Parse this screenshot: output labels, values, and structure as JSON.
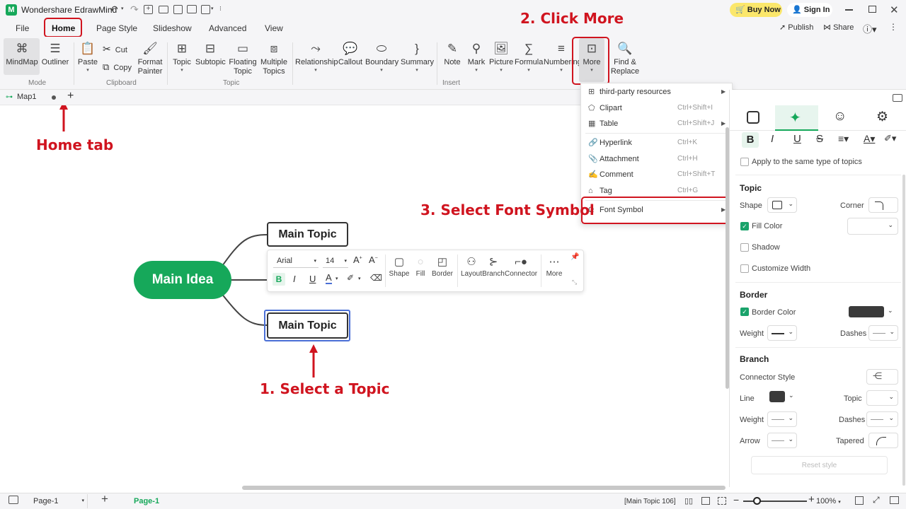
{
  "app": {
    "title": "Wondershare EdrawMind",
    "buy_now": "Buy Now",
    "sign_in": "Sign In",
    "publish": "Publish",
    "share": "Share"
  },
  "menu": {
    "file": "File",
    "home": "Home",
    "page_style": "Page Style",
    "slideshow": "Slideshow",
    "advanced": "Advanced",
    "view": "View"
  },
  "ribbon": {
    "mindmap": "MindMap",
    "outliner": "Outliner",
    "mode": "Mode",
    "paste": "Paste",
    "cut": "Cut",
    "copy": "Copy",
    "format_painter_1": "Format",
    "format_painter_2": "Painter",
    "clipboard": "Clipboard",
    "topic": "Topic",
    "subtopic": "Subtopic",
    "floating_1": "Floating",
    "floating_2": "Topic",
    "multiple_1": "Multiple",
    "multiple_2": "Topics",
    "topic_group": "Topic",
    "relationship": "Relationship",
    "callout": "Callout",
    "boundary": "Boundary",
    "summary": "Summary",
    "note": "Note",
    "mark": "Mark",
    "picture": "Picture",
    "formula": "Formula",
    "numbering": "Numbering",
    "more": "More",
    "insert": "Insert",
    "find_1": "Find &",
    "find_2": "Replace"
  },
  "doc_tab": {
    "name": "Map1"
  },
  "annotations": {
    "home_tab": "Home tab",
    "click_more": "2. Click More",
    "select_font_symbol": "3. Select Font Symbol",
    "select_topic": "1. Select a Topic"
  },
  "mindmap": {
    "main_idea": "Main Idea",
    "topic_top": "Main Topic",
    "topic_bottom": "Main Topic"
  },
  "floating_toolbar": {
    "font": "Arial",
    "size": "14",
    "shape": "Shape",
    "fill": "Fill",
    "border": "Border",
    "layout": "Layout",
    "branch": "Branch",
    "connector": "Connector",
    "more": "More"
  },
  "more_menu": {
    "items": [
      {
        "label": "third-party resources",
        "shortcut": ""
      },
      {
        "label": "Clipart",
        "shortcut": "Ctrl+Shift+I"
      },
      {
        "label": "Table",
        "shortcut": "Ctrl+Shift+J"
      },
      {
        "label": "Hyperlink",
        "shortcut": "Ctrl+K"
      },
      {
        "label": "Attachment",
        "shortcut": "Ctrl+H"
      },
      {
        "label": "Comment",
        "shortcut": "Ctrl+Shift+T"
      },
      {
        "label": "Tag",
        "shortcut": "Ctrl+G"
      },
      {
        "label": "Font Symbol",
        "shortcut": ""
      }
    ]
  },
  "panel": {
    "apply_same": "Apply to the same type of topics",
    "topic": "Topic",
    "shape": "Shape",
    "corner": "Corner",
    "fill_color": "Fill Color",
    "shadow": "Shadow",
    "customize_width": "Customize Width",
    "border": "Border",
    "border_color": "Border Color",
    "weight": "Weight",
    "dashes": "Dashes",
    "branch": "Branch",
    "connector_style": "Connector Style",
    "line": "Line",
    "topic_lbl": "Topic",
    "weight2": "Weight",
    "dashes2": "Dashes",
    "arrow": "Arrow",
    "tapered": "Tapered",
    "reset_style": "Reset style"
  },
  "status": {
    "page_select": "Page-1",
    "page_tab": "Page-1",
    "selection": "[Main Topic 106]",
    "zoom": "100%"
  },
  "colors": {
    "accent_green": "#16a85a",
    "annotation_red": "#d0141f",
    "selection_blue": "#4a6fd6"
  }
}
